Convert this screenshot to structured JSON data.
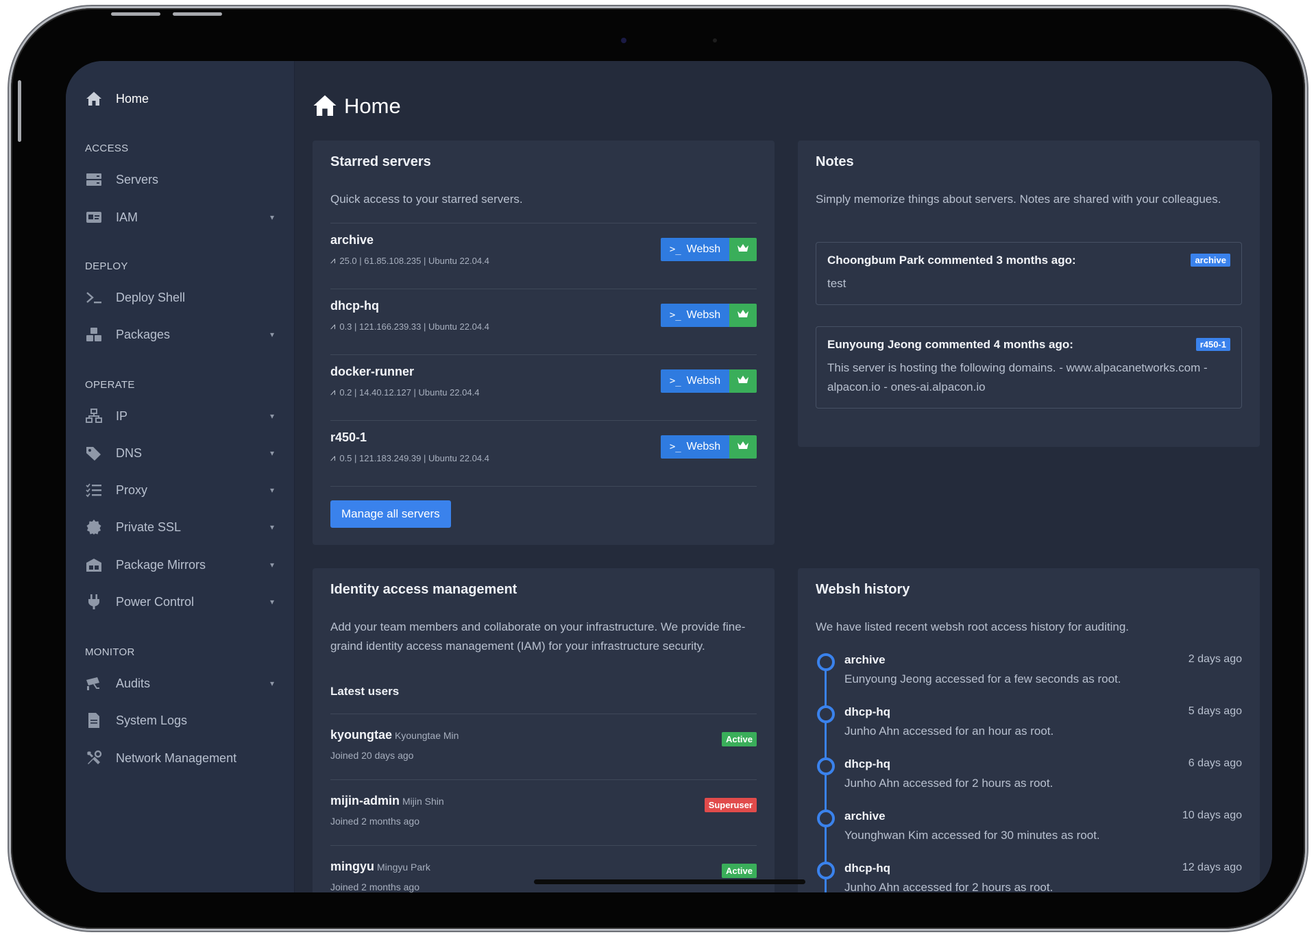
{
  "sidebar": {
    "home": {
      "label": "Home",
      "icon": "home-icon"
    },
    "sections": {
      "access": "ACCESS",
      "deploy": "DEPLOY",
      "operate": "OPERATE",
      "monitor": "MONITOR"
    },
    "items": {
      "servers": {
        "label": "Servers",
        "icon": "server-icon"
      },
      "iam": {
        "label": "IAM",
        "icon": "id-card-icon"
      },
      "deploy_shell": {
        "label": "Deploy Shell",
        "icon": "terminal-icon"
      },
      "packages": {
        "label": "Packages",
        "icon": "cubes-icon"
      },
      "ip": {
        "label": "IP",
        "icon": "network-icon"
      },
      "dns": {
        "label": "DNS",
        "icon": "tag-icon"
      },
      "proxy": {
        "label": "Proxy",
        "icon": "list-check-icon"
      },
      "private_ssl": {
        "label": "Private SSL",
        "icon": "certificate-icon"
      },
      "package_mirrors": {
        "label": "Package Mirrors",
        "icon": "warehouse-icon"
      },
      "power_control": {
        "label": "Power Control",
        "icon": "plug-icon"
      },
      "audits": {
        "label": "Audits",
        "icon": "cctv-icon"
      },
      "system_logs": {
        "label": "System Logs",
        "icon": "file-icon"
      },
      "network_management": {
        "label": "Network Management",
        "icon": "tools-icon"
      }
    }
  },
  "main": {
    "title": "Home",
    "starred": {
      "title": "Starred servers",
      "subtitle": "Quick access to your starred servers.",
      "websh_label": "Websh",
      "servers": [
        {
          "name": "archive",
          "meta": "25.0 | 61.85.108.235 | Ubuntu 22.04.4"
        },
        {
          "name": "dhcp-hq",
          "meta": "0.3 | 121.166.239.33 | Ubuntu 22.04.4"
        },
        {
          "name": "docker-runner",
          "meta": "0.2 | 14.40.12.127 | Ubuntu 22.04.4"
        },
        {
          "name": "r450-1",
          "meta": "0.5 | 121.183.249.39 | Ubuntu 22.04.4"
        }
      ],
      "manage_label": "Manage all servers"
    },
    "notes": {
      "title": "Notes",
      "subtitle": "Simply memorize things about servers. Notes are shared with your colleagues.",
      "items": [
        {
          "header": "Choongbum Park commented 3 months ago:",
          "tag": "archive",
          "body": "test"
        },
        {
          "header": "Eunyoung Jeong commented 4 months ago:",
          "tag": "r450-1",
          "body": "This server is hosting the following domains. - www.alpacanetworks.com - alpacon.io - ones-ai.alpacon.io"
        }
      ]
    },
    "iam": {
      "title": "Identity access management",
      "subtitle": "Add your team members and collaborate on your infrastructure. We provide fine-graind identity access management (IAM) for your infrastructure security.",
      "latest_users_label": "Latest users",
      "users": [
        {
          "username": "kyoungtae",
          "fullname": "Kyoungtae Min",
          "joined": "Joined 20 days ago",
          "badge": "Active"
        },
        {
          "username": "mijin-admin",
          "fullname": "Mijin Shin",
          "joined": "Joined 2 months ago",
          "badge": "Superuser"
        },
        {
          "username": "mingyu",
          "fullname": "Mingyu Park",
          "joined": "Joined 2 months ago",
          "badge": "Active"
        }
      ]
    },
    "websh_history": {
      "title": "Websh history",
      "subtitle": "We have listed recent websh root access history for auditing.",
      "items": [
        {
          "server": "archive",
          "time": "2 days ago",
          "desc": "Eunyoung Jeong accessed for a few seconds as root."
        },
        {
          "server": "dhcp-hq",
          "time": "5 days ago",
          "desc": "Junho Ahn accessed for an hour as root."
        },
        {
          "server": "dhcp-hq",
          "time": "6 days ago",
          "desc": "Junho Ahn accessed for 2 hours as root."
        },
        {
          "server": "archive",
          "time": "10 days ago",
          "desc": "Younghwan Kim accessed for 30 minutes as root."
        },
        {
          "server": "dhcp-hq",
          "time": "12 days ago",
          "desc": "Junho Ahn accessed for 2 hours as root."
        }
      ]
    }
  },
  "colors": {
    "accent": "#3a82ec",
    "success": "#3aae5a",
    "danger": "#e14b4b",
    "sidebar_bg": "#273044",
    "main_bg": "#242b3b",
    "card_bg": "#2c3446"
  }
}
